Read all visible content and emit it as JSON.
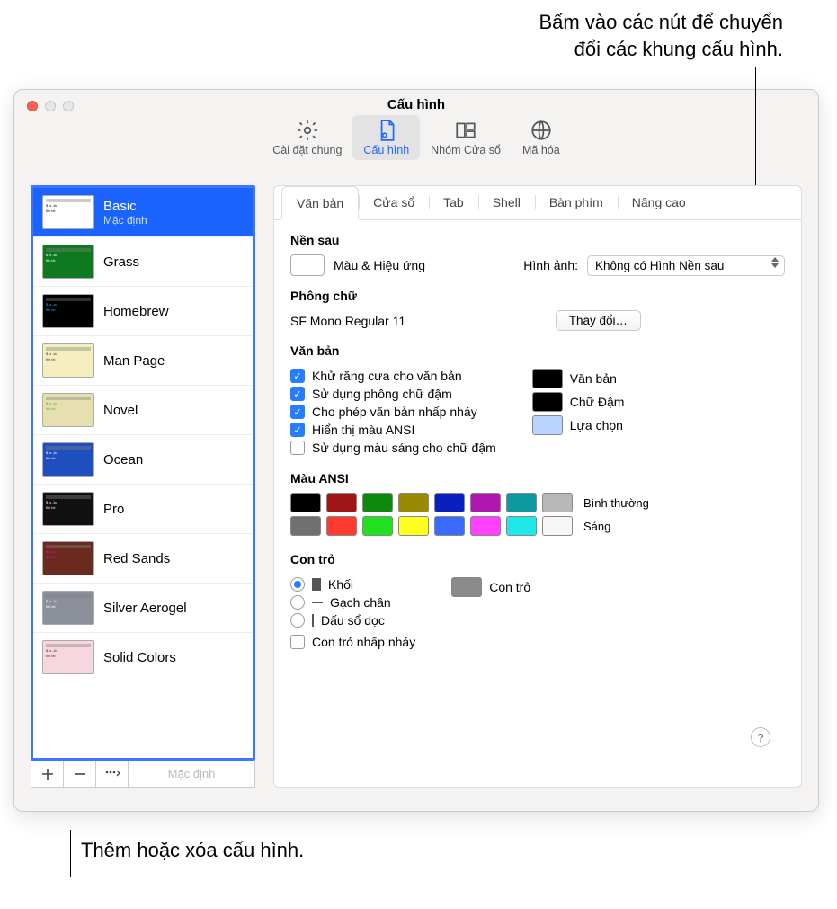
{
  "callouts": {
    "top_l1": "Bấm vào các nút để chuyển",
    "top_l2": "đổi các khung cấu hình.",
    "bottom": "Thêm hoặc xóa cấu hình."
  },
  "title": "Cấu hình",
  "toolbar": {
    "general": "Cài đặt chung",
    "profiles": "Cấu hình",
    "groups": "Nhóm Cửa sổ",
    "encoding": "Mã hóa"
  },
  "profiles": [
    {
      "name": "Basic",
      "sub": "Mặc định",
      "bg": "#ffffff",
      "fg": "#000"
    },
    {
      "name": "Grass",
      "bg": "#0e7a1f",
      "fg": "#ffe"
    },
    {
      "name": "Homebrew",
      "bg": "#000",
      "fg": "#2af"
    },
    {
      "name": "Man Page",
      "bg": "#f5efbf",
      "fg": "#333"
    },
    {
      "name": "Novel",
      "bg": "#e7dfb0",
      "fg": "#5a4"
    },
    {
      "name": "Ocean",
      "bg": "#1f4fbf",
      "fg": "#fff"
    },
    {
      "name": "Pro",
      "bg": "#111",
      "fg": "#eee"
    },
    {
      "name": "Red Sands",
      "bg": "#6b2a20",
      "fg": "#f0d"
    },
    {
      "name": "Silver Aerogel",
      "bg": "#8a8f9a",
      "fg": "#fff"
    },
    {
      "name": "Solid Colors",
      "bg": "#f6d7df",
      "fg": "#333"
    }
  ],
  "sidebar_toolbar": {
    "default_label": "Mặc định"
  },
  "tabs": [
    "Văn bản",
    "Cửa sổ",
    "Tab",
    "Shell",
    "Bàn phím",
    "Nâng cao"
  ],
  "sections": {
    "background": {
      "title": "Nền sau",
      "color_effects": "Màu & Hiệu ứng",
      "image_label": "Hình ảnh:",
      "image_value": "Không có Hình Nền sau"
    },
    "font": {
      "title": "Phông chữ",
      "current": "SF Mono Regular 11",
      "change": "Thay đổi…"
    },
    "text": {
      "title": "Văn bản",
      "antialias": "Khử răng cưa cho văn bản",
      "bold": "Sử dụng phông chữ đậm",
      "blink": "Cho phép văn bản nhấp nháy",
      "ansi": "Hiển thị màu ANSI",
      "bright_bold": "Sử dụng màu sáng cho chữ đậm",
      "text_swatch": "Văn bản",
      "bold_swatch": "Chữ Đậm",
      "selection": "Lựa chọn"
    },
    "ansi": {
      "title": "Màu ANSI",
      "normal": "Bình thường",
      "bright": "Sáng",
      "normal_colors": [
        "#000000",
        "#a01515",
        "#0d8a0d",
        "#9a8a00",
        "#0a1fc0",
        "#b016b0",
        "#0a9aa0",
        "#b8b8b8"
      ],
      "bright_colors": [
        "#707070",
        "#ff3b30",
        "#20e020",
        "#ffff20",
        "#3a6aff",
        "#ff40ff",
        "#20e8e8",
        "#f6f6f6"
      ]
    },
    "cursor": {
      "title": "Con trỏ",
      "block": "Khối",
      "underline": "Gạch chân",
      "bar": "Dấu sổ dọc",
      "blink": "Con trỏ nhấp nháy",
      "swatch": "Con trỏ"
    }
  }
}
